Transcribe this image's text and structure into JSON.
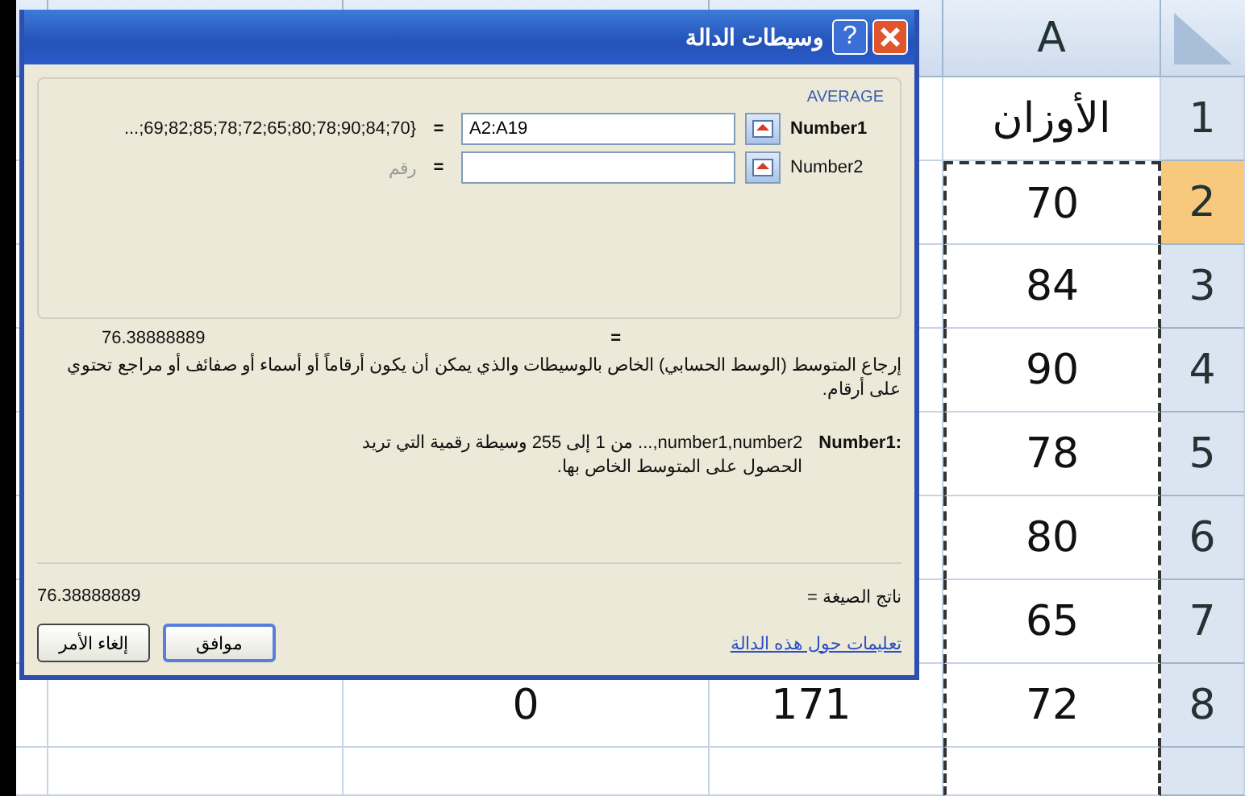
{
  "sheet": {
    "column_header": "A",
    "rows": [
      {
        "number": "1",
        "value": "الأوزان",
        "selected": false,
        "cells": []
      },
      {
        "number": "2",
        "value": "70",
        "selected": true,
        "cells": []
      },
      {
        "number": "3",
        "value": "84",
        "selected": false,
        "cells": []
      },
      {
        "number": "4",
        "value": "90",
        "selected": false,
        "cells": []
      },
      {
        "number": "5",
        "value": "78",
        "selected": false,
        "cells": []
      },
      {
        "number": "6",
        "value": "80",
        "selected": false,
        "cells": []
      },
      {
        "number": "7",
        "value": "65",
        "selected": false,
        "cells": []
      },
      {
        "number": "8",
        "value": "72",
        "selected": false,
        "cells": [
          "171",
          "0"
        ]
      }
    ]
  },
  "dialog": {
    "title": "وسيطات الدالة",
    "help": "?",
    "function_name": "AVERAGE",
    "arguments": [
      {
        "label": "Number1",
        "required": true,
        "value": "A2:A19",
        "result": "...;69;82;85;78;72;65;80;78;90;84;70}",
        "result_is_hint": false
      },
      {
        "label": "Number2",
        "required": false,
        "result": "رقم",
        "result_is_hint": true
      }
    ],
    "equals": "=",
    "result": "76.38888889",
    "description": "إرجاع المتوسط (الوسط الحسابي) الخاص بالوسيطات والذي يمكن أن يكون أرقاماً أو أسماء أو صفائف أو مراجع تحتوي على أرقام.",
    "argument_label": "Number1:",
    "argument_description": "number1,number2,... من 1 إلى 255 وسيطة رقمية التي تريد الحصول على المتوسط الخاص بها.",
    "formula_result_label": "ناتج الصيغة =",
    "formula_result": "76.38888889",
    "help_link": "تعليمات حول هذه الدالة",
    "buttons": [
      {
        "label": "موافق",
        "default": true
      },
      {
        "label": "إلغاء الأمر",
        "default": false
      }
    ]
  }
}
